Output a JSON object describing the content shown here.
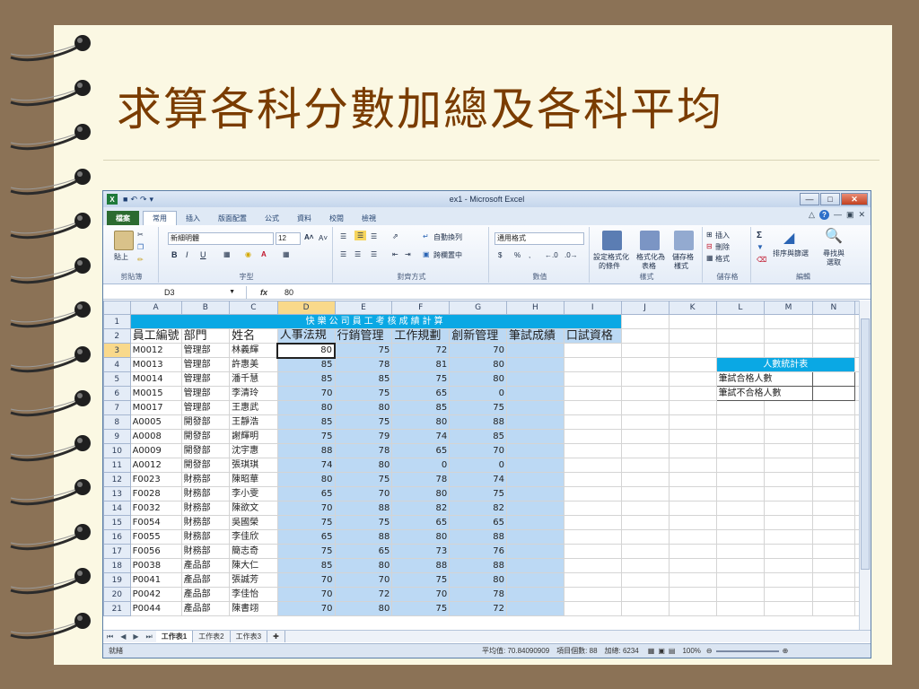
{
  "slide": {
    "title": "求算各科分數加總及各科平均"
  },
  "excel": {
    "window_title": "ex1 - Microsoft Excel",
    "app_icon": "X",
    "tabs": [
      "檔案",
      "常用",
      "插入",
      "版面配置",
      "公式",
      "資料",
      "校閱",
      "檢視"
    ],
    "ribbon": {
      "clipboard": {
        "paste": "貼上",
        "label": "剪貼簿"
      },
      "font": {
        "name": "新細明體",
        "size": "12",
        "bold": "B",
        "italic": "I",
        "underline": "U",
        "label": "字型"
      },
      "alignment": {
        "wrap": "自動換列",
        "merge": "跨欄置中",
        "label": "對齊方式"
      },
      "number": {
        "format": "通用格式",
        "currency": "$",
        "percent": "%",
        "comma": ",",
        "label": "數值"
      },
      "styles": {
        "conditional_1": "設定格式化",
        "conditional_2": "的條件",
        "table_1": "格式化為",
        "table_2": "表格",
        "cell_1": "儲存格",
        "cell_2": "樣式",
        "label": "樣式"
      },
      "cells": {
        "insert": "插入",
        "delete": "刪除",
        "format": "格式",
        "label": "儲存格"
      },
      "editing": {
        "sigma": "Σ",
        "sort_1": "排序與篩選",
        "find_1": "尋找與",
        "find_2": "選取",
        "label": "編輯"
      }
    },
    "name_box": "D3",
    "fx": "fx",
    "formula_value": "80",
    "columns": [
      "A",
      "B",
      "C",
      "D",
      "E",
      "F",
      "G",
      "H",
      "I",
      "J",
      "K",
      "L",
      "M",
      "N"
    ],
    "sheet_title": "快樂公司員工考核成績計算",
    "headers": [
      "員工編號",
      "部門",
      "姓名",
      "人事法規",
      "行銷管理",
      "工作規劃",
      "創新管理",
      "筆試成績",
      "口試資格"
    ],
    "rows": [
      [
        "M0012",
        "管理部",
        "林義輝",
        "80",
        "75",
        "72",
        "70"
      ],
      [
        "M0013",
        "管理部",
        "許惠美",
        "85",
        "78",
        "81",
        "80"
      ],
      [
        "M0014",
        "管理部",
        "潘千慧",
        "85",
        "85",
        "75",
        "80"
      ],
      [
        "M0015",
        "管理部",
        "李清玲",
        "70",
        "75",
        "65",
        "0"
      ],
      [
        "M0017",
        "管理部",
        "王惠武",
        "80",
        "80",
        "85",
        "75"
      ],
      [
        "A0005",
        "開發部",
        "王靜浩",
        "85",
        "75",
        "80",
        "88"
      ],
      [
        "A0008",
        "開發部",
        "謝輝明",
        "75",
        "79",
        "74",
        "85"
      ],
      [
        "A0009",
        "開發部",
        "沈宇惠",
        "88",
        "78",
        "65",
        "70"
      ],
      [
        "A0012",
        "開發部",
        "張琪琪",
        "74",
        "80",
        "0",
        "0"
      ],
      [
        "F0023",
        "財務部",
        "陳昭華",
        "80",
        "75",
        "78",
        "74"
      ],
      [
        "F0028",
        "財務部",
        "李小雯",
        "65",
        "70",
        "80",
        "75"
      ],
      [
        "F0032",
        "財務部",
        "陳欲文",
        "70",
        "88",
        "82",
        "82"
      ],
      [
        "F0054",
        "財務部",
        "吳國榮",
        "75",
        "75",
        "65",
        "65"
      ],
      [
        "F0055",
        "財務部",
        "李佳欣",
        "65",
        "88",
        "80",
        "88"
      ],
      [
        "F0056",
        "財務部",
        "簡志奇",
        "75",
        "65",
        "73",
        "76"
      ],
      [
        "P0038",
        "產品部",
        "陳大仁",
        "85",
        "80",
        "88",
        "88"
      ],
      [
        "P0041",
        "產品部",
        "張誠芳",
        "70",
        "70",
        "75",
        "80"
      ],
      [
        "P0042",
        "產品部",
        "李佳怡",
        "70",
        "72",
        "70",
        "78"
      ],
      [
        "P0044",
        "產品部",
        "陳書翊",
        "70",
        "80",
        "75",
        "72"
      ]
    ],
    "stats": {
      "title": "人數統計表",
      "pass_label": "筆試合格人數",
      "fail_label": "筆試不合格人數"
    },
    "sheet_tabs": [
      "工作表1",
      "工作表2",
      "工作表3"
    ],
    "status": {
      "ready": "就緒",
      "average": "平均值: 70.84090909",
      "count": "項目個數: 88",
      "sum": "加總: 6234",
      "zoom": "100%"
    }
  }
}
